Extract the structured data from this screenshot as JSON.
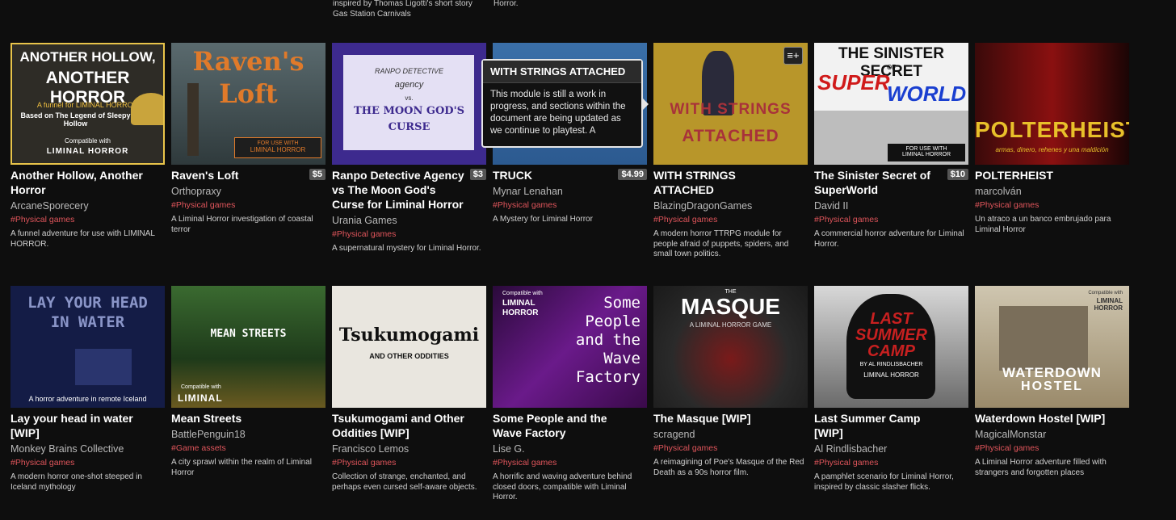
{
  "top_fragments": {
    "left_line1": "inspired by Thomas Ligotti's short story",
    "left_line2": "Gas Station Carnivals",
    "right_line1": "Horror."
  },
  "tooltip": {
    "title": "WITH STRINGS ATTACHED",
    "body": "This module is still a work in progress, and sections within the document are being updated as we continue to playtest. A"
  },
  "rows": [
    {
      "games": [
        {
          "title": "Another Hollow, Another Horror",
          "author": "ArcaneSporecery",
          "price": "",
          "tag": "#Physical games",
          "desc": "A funnel adventure for use with LIMINAL HORROR.",
          "cover": {
            "l1": "ANOTHER HOLLOW,",
            "l2": "ANOTHER HORROR",
            "l3": "A funnel for LIMINAL HORROR",
            "l4": "Based on The Legend of Sleepy Hollow",
            "l5": "Compatible with",
            "l6": "LIMINAL HORROR"
          }
        },
        {
          "title": "Raven's Loft",
          "author": "Orthopraxy",
          "price": "$5",
          "tag": "#Physical games",
          "desc": "A Liminal Horror investigation of coastal terror",
          "cover": {
            "l1": "Raven's",
            "l2": "Loft",
            "l3": "FOR USE WITH",
            "l4": "LIMINAL HORROR"
          }
        },
        {
          "title": "Ranpo Detective Agency vs The Moon God's Curse for Liminal Horror",
          "author": "Urania Games",
          "price": "$3",
          "tag": "#Physical games",
          "desc": "A supernatural mystery for Liminal Horror.",
          "cover": {
            "l1": "RANPO DETECTIVE",
            "l2": "agency",
            "l3": "vs.",
            "l4": "THE MOON GOD'S",
            "l5": "CURSE"
          }
        },
        {
          "title": "TRUCK",
          "author": "Mynar Lenahan",
          "price": "$4.99",
          "tag": "#Physical games",
          "desc": "A Mystery for Liminal Horror",
          "cover": {}
        },
        {
          "title": "WITH STRINGS ATTACHED",
          "author": "BlazingDragonGames",
          "price": "",
          "tag": "#Physical games",
          "desc": "A modern horror TTRPG module for people afraid of puppets, spiders, and small town politics.",
          "cover": {
            "l1": "WITH STRINGS",
            "l2": "ATTACHED"
          }
        },
        {
          "title": "The Sinister Secret of SuperWorld",
          "author": "David II",
          "price": "$10",
          "tag": "#Physical games",
          "desc": "A commercial horror adventure for Liminal Horror.",
          "cover": {
            "l1": "THE SINISTER SECRET",
            "l2": "OF",
            "l3": "SUPER",
            "l4": "WORLD",
            "l5": "FOR USE WITH",
            "l6": "LIMINAL HORROR"
          }
        },
        {
          "title": "POLTERHEIST",
          "author": "marcolván",
          "price": "",
          "tag": "#Physical games",
          "desc": "Un atraco a un banco embrujado para Liminal Horror",
          "cover": {
            "l1": "POLTERHEIST",
            "l2": "armas, dinero, rehenes y una maldición"
          }
        }
      ]
    },
    {
      "games": [
        {
          "title": "Lay your head in water [WIP]",
          "author": "Monkey Brains Collective",
          "price": "",
          "tag": "#Physical games",
          "desc": "A modern horror one-shot steeped in Iceland mythology",
          "cover": {
            "l1": "LAY YOUR HEAD",
            "l2": "IN WATER",
            "l3": "A horror adventure in remote Iceland"
          }
        },
        {
          "title": "Mean Streets",
          "author": "BattlePenguin18",
          "price": "",
          "tag": "#Game assets",
          "desc": "A city sprawl within the realm of Liminal Horror",
          "cover": {
            "l1": "MEAN STREETS",
            "l2": "Compatible with",
            "l3": "LIMINAL"
          }
        },
        {
          "title": "Tsukumogami and Other Oddities [WIP]",
          "author": "Francisco Lemos",
          "price": "",
          "tag": "#Physical games",
          "desc": "Collection of strange, enchanted, and perhaps even cursed self-aware objects.",
          "cover": {
            "l1": "Tsukumogami",
            "l2": "AND OTHER ODDITIES"
          }
        },
        {
          "title": "Some People and the Wave Factory",
          "author": "Lise G.",
          "price": "",
          "tag": "#Physical games",
          "desc": "A horrific and waving adventure behind closed doors, compatible with Liminal Horror.",
          "cover": {
            "l1": "Some",
            "l2": "People",
            "l3": "and the",
            "l4": "Wave",
            "l5": "Factory",
            "l6": "Compatible with",
            "l7": "LIMINAL HORROR"
          }
        },
        {
          "title": "The Masque [WIP]",
          "author": "scragend",
          "price": "",
          "tag": "#Physical games",
          "desc": "A reimagining of Poe's Masque of the Red Death as a 90s horror film.",
          "cover": {
            "l1": "THE",
            "l2": "MASQUE",
            "l3": "A LIMINAL HORROR GAME"
          }
        },
        {
          "title": "Last Summer Camp [WIP]",
          "author": "Al Rindlisbacher",
          "price": "",
          "tag": "#Physical games",
          "desc": "A pamphlet scenario for Liminal Horror, inspired by classic slasher flicks.",
          "cover": {
            "l1": "LAST",
            "l2": "SUMMER",
            "l3": "CAMP",
            "l4": "BY AL RINDLISBACHER",
            "l5": "LIMINAL HORROR"
          }
        },
        {
          "title": "Waterdown Hostel [WIP]",
          "author": "MagicalMonstar",
          "price": "",
          "tag": "#Physical games",
          "desc": "A Liminal Horror adventure filled with strangers and forgotten places",
          "cover": {
            "l1": "WATERDOWN",
            "l2": "HOSTEL",
            "l3": "Compatible with",
            "l4": "LIMINAL HORROR"
          }
        }
      ]
    }
  ]
}
